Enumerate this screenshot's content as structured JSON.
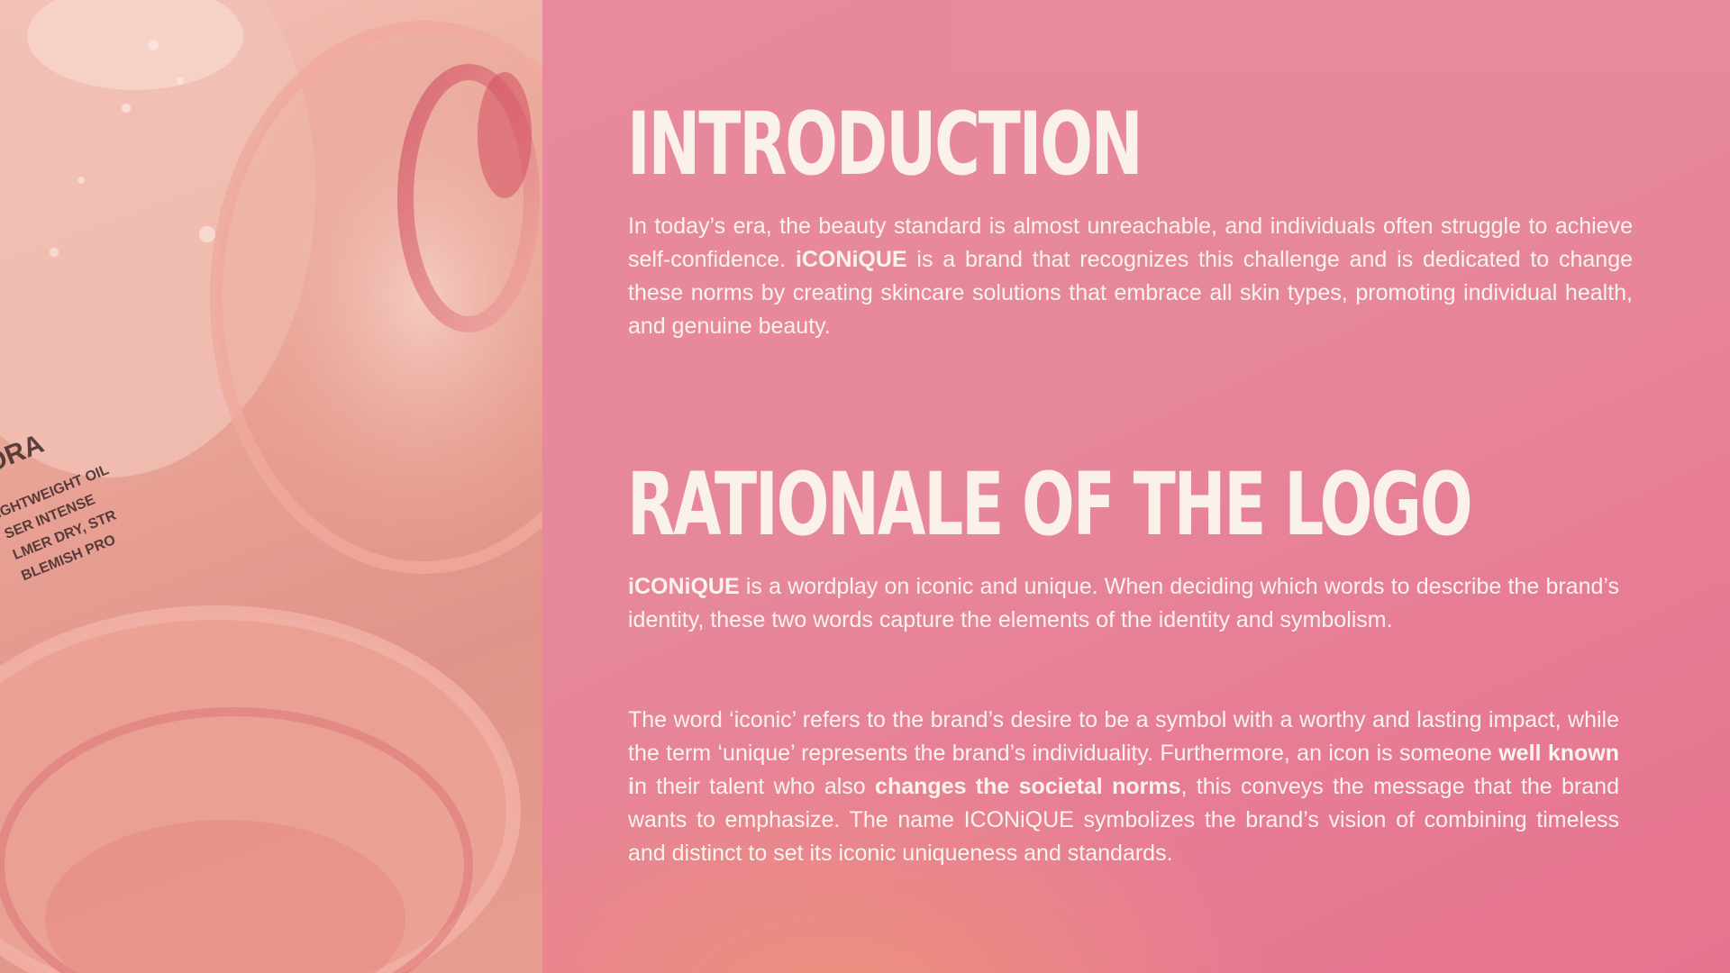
{
  "colors": {
    "background_pink": "#e8879a",
    "heading_text": "#faf1ea",
    "body_text": "#fbf3ee",
    "photo_tint": "#eaa497"
  },
  "photo": {
    "jar_label_text": [
      "ORA",
      "IGHTWEIGHT OIL",
      "SER INTENSE",
      "LMER DRY, STR",
      "BLEMISH PRO"
    ]
  },
  "introduction": {
    "title": "INTRODUCTION",
    "text_1": "In today’s era, the beauty standard is almost unreachable, and individuals often struggle to achieve self-confidence. ",
    "brand": "iCONiQUE",
    "text_2": " is a brand that recognizes this challenge and is dedicated to change these norms by creating skincare solutions that embrace all skin types, promoting individual health, and genuine beauty."
  },
  "rationale": {
    "title": "RATIONALE OF THE LOGO",
    "para1_brand": "iCONiQUE",
    "para1_text": " is a wordplay on iconic and unique. When deciding which words to describe the brand’s identity, these two words capture the elements of the identity and symbolism.",
    "para2_text_1": "The word ‘iconic’ refers to the brand’s desire to be a symbol with a worthy and lasting impact, while the term ‘unique’ represents the brand’s individuality.  Furthermore, an icon is someone ",
    "para2_bold_1": "well known i",
    "para2_text_2": "n their talent who also ",
    "para2_bold_2": "changes the societal norms",
    "para2_text_3": ", this conveys the message that the brand wants to emphasize. The name ICONiQUE symbolizes the brand’s vision of combining timeless and distinct to set its iconic uniqueness and standards."
  }
}
